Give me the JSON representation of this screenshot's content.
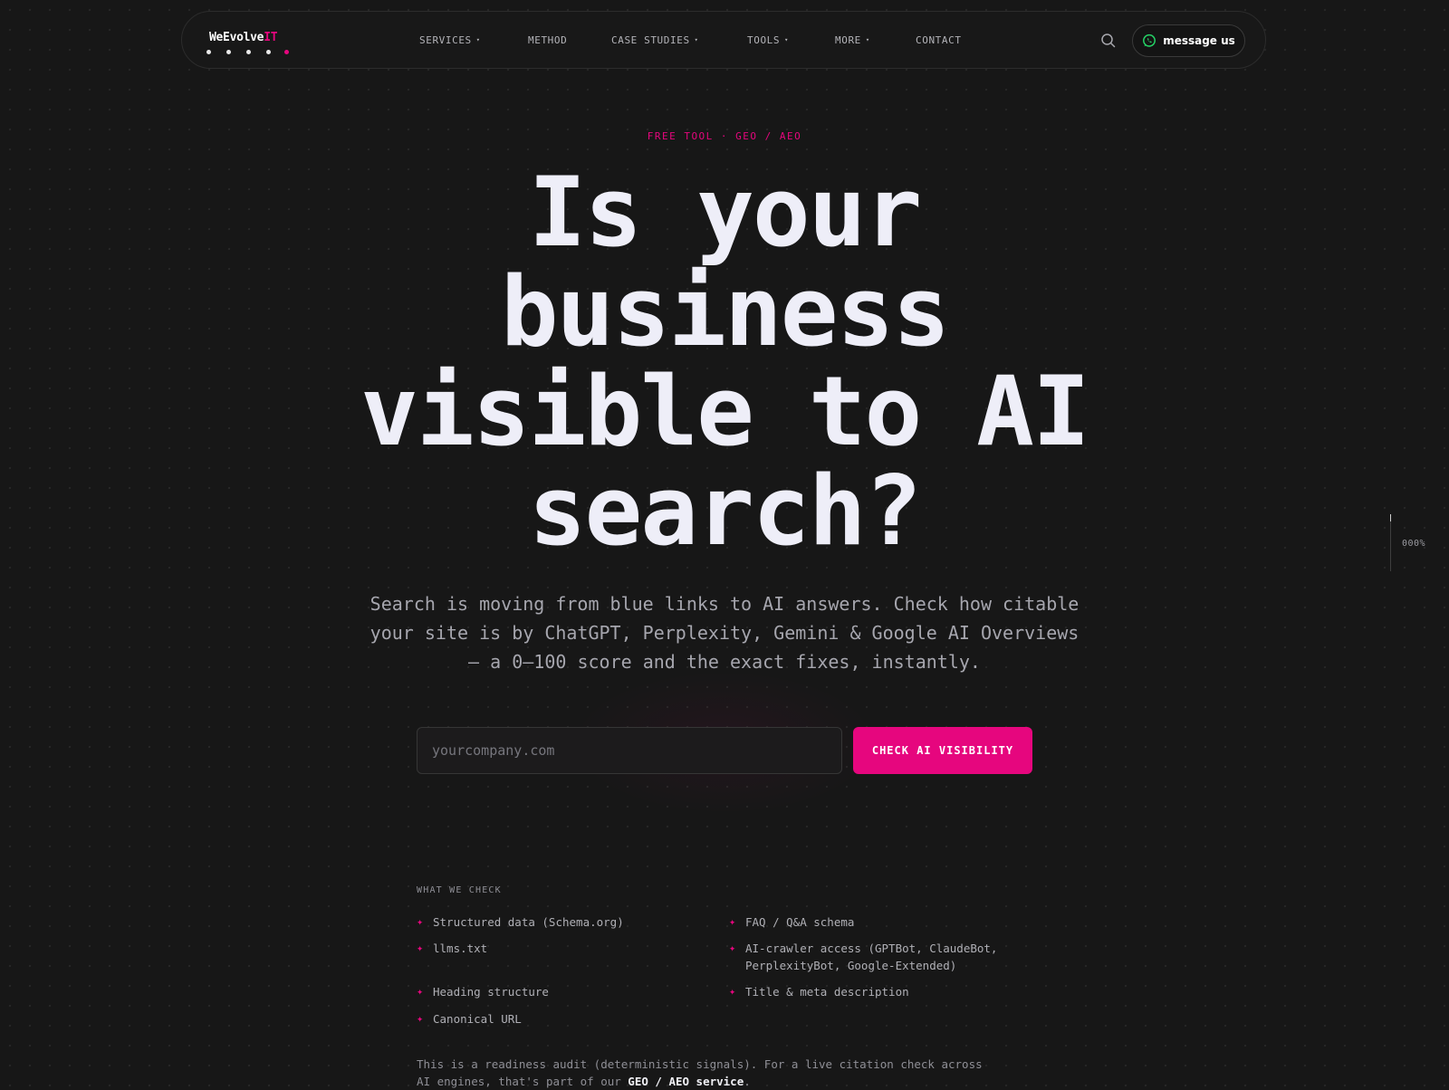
{
  "nav": {
    "logo_main": "WeEvolve",
    "logo_accent": "IT",
    "items": [
      {
        "label": "SERVICES",
        "dropdown": true
      },
      {
        "label": "METHOD",
        "dropdown": false
      },
      {
        "label": "CASE STUDIES",
        "dropdown": true
      },
      {
        "label": "TOOLS",
        "dropdown": true
      },
      {
        "label": "MORE",
        "dropdown": true
      },
      {
        "label": "CONTACT",
        "dropdown": false
      }
    ],
    "message_button": "message us",
    "caret": "▾"
  },
  "hero": {
    "eyebrow": "FREE TOOL · GEO / AEO",
    "headline_lines": [
      "Is your",
      "business",
      "visible to AI",
      "search?"
    ],
    "subtext": "Search is moving from blue links to AI answers. Check how citable your site is by ChatGPT, Perplexity, Gemini & Google AI Overviews — a 0–100 score and the exact fixes, instantly.",
    "input_placeholder": "yourcompany.com",
    "cta_label": "CHECK AI VISIBILITY"
  },
  "scroll_progress": {
    "label": "000%",
    "value": 0
  },
  "checks": {
    "title": "WHAT WE CHECK",
    "star": "✦",
    "items": [
      "Structured data (Schema.org)",
      "FAQ / Q&A schema",
      "llms.txt",
      "AI-crawler access (GPTBot, ClaudeBot, PerplexityBot, Google-Extended)",
      "Heading structure",
      "Title & meta description",
      "Canonical URL"
    ]
  },
  "footnote": {
    "text": "This is a readiness audit (deterministic signals). For a live citation check across AI engines, that's part of our ",
    "link": "GEO / AEO service",
    "end": "."
  },
  "colors": {
    "accent": "#e6067e",
    "background": "#171717",
    "whatsapp": "#25d366"
  }
}
